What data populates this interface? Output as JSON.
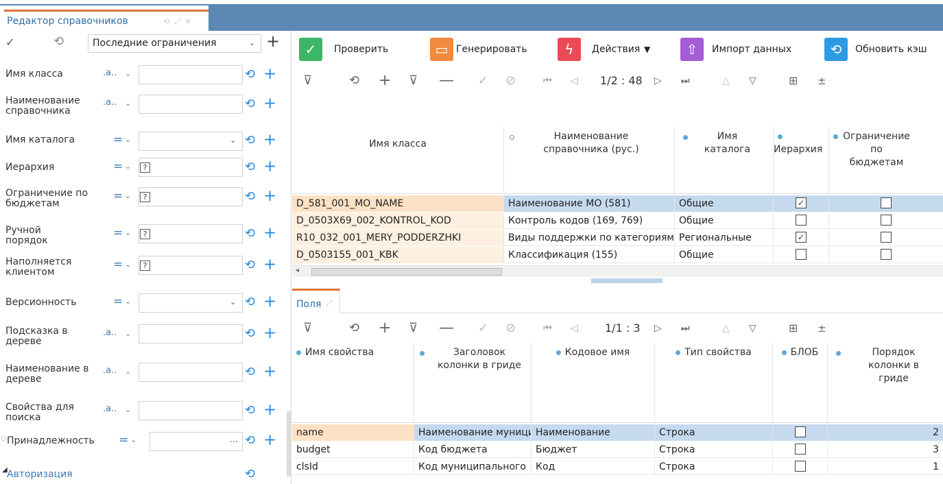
{
  "title_tab": {
    "label": "Редактор справочников"
  },
  "filter_panel": {
    "preset_select": "Последние ограничения",
    "ops": {
      "contains": ".a..",
      "equals": "="
    },
    "rows": [
      {
        "label": "Имя класса"
      },
      {
        "label": "Наименование справочника"
      },
      {
        "label": "Имя каталога"
      },
      {
        "label": "Иерархия"
      },
      {
        "label": "Ограничение по бюджетам"
      },
      {
        "label": "Ручной порядок"
      },
      {
        "label": "Наполняется клиентом"
      },
      {
        "label": "Версионность"
      },
      {
        "label": "Подсказка в дереве"
      },
      {
        "label": "Наименование в дереве"
      },
      {
        "label": "Свойства для поиска"
      },
      {
        "label": "Принадлежность"
      }
    ],
    "auth_label": "Авторизация",
    "ellipsis": "..."
  },
  "actions": {
    "check": "Проверить",
    "generate": "Генерировать",
    "actions": "Действия",
    "import": "Импорт данных",
    "refresh": "Обновить кэш"
  },
  "top_grid": {
    "pager": "1/2 : 48",
    "headers": [
      "Имя класса",
      "Наименование справочника (рус.)",
      "Имя каталога",
      "Иерархия",
      "Ограничение по бюджетам"
    ],
    "rows": [
      {
        "cls": "D_581_001_MO_NAME",
        "name": "Наименование МО (581)",
        "cat": "Общие",
        "hier": true,
        "budget": false
      },
      {
        "cls": "D_0503X69_002_KONTROL_KOD",
        "name": "Контроль кодов (169, 769)",
        "cat": "Общие",
        "hier": false,
        "budget": false
      },
      {
        "cls": "R10_032_001_MERY_PODDERZHKI",
        "name": "Виды поддержки по категориям",
        "cat": "Региональные",
        "hier": true,
        "budget": false
      },
      {
        "cls": "D_0503155_001_KBK",
        "name": "Классификация (155)",
        "cat": "Общие",
        "hier": false,
        "budget": false
      }
    ]
  },
  "fields_tab": {
    "label": "Поля"
  },
  "bottom_grid": {
    "pager": "1/1 : 3",
    "headers": [
      "Имя свойства",
      "Заголовок колонки в гриде",
      "Кодовое имя",
      "Тип свойства",
      "БЛОБ",
      "Порядок колонки в гриде"
    ],
    "rows": [
      {
        "prop": "name",
        "title": "Наименование муниципального",
        "code": "Наименование",
        "type": "Строка",
        "blob": false,
        "order": "2"
      },
      {
        "prop": "budget",
        "title": "Код бюджета",
        "code": "Бюджет",
        "type": "Строка",
        "blob": false,
        "order": "3"
      },
      {
        "prop": "clsId",
        "title": "Код муниципального",
        "code": "Код",
        "type": "Строка",
        "blob": false,
        "order": "1"
      }
    ]
  },
  "colors": {
    "accent": "#2c8ad6",
    "tab_accent": "#e07238",
    "title_strip": "#5d87b5",
    "selected": "#c6daef",
    "first_col": "#fde1c4"
  }
}
